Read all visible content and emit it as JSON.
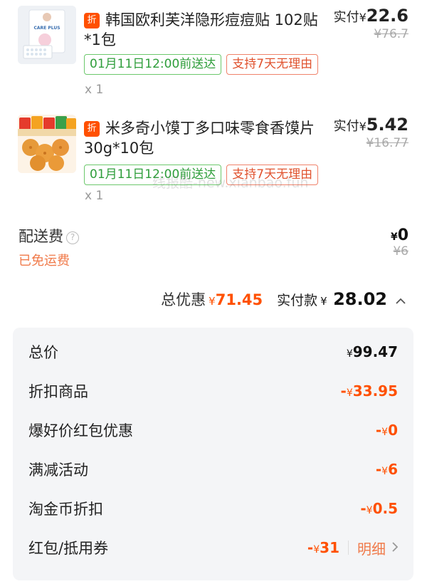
{
  "items": [
    {
      "badge": "折",
      "title": "韩国欧利芙洋隐形痘痘贴 102贴*1包",
      "tag_delivery": "01月11日12:00前送达",
      "tag_return": "支持7天无理由",
      "qty": "x 1",
      "paid_label": "实付",
      "paid_currency": "¥",
      "paid_amount": "22.6",
      "orig_price": "¥76.7",
      "thumb_text": "CARE PLUS"
    },
    {
      "badge": "折",
      "title": "米多奇小馍丁多口味零食香馍片 30g*10包",
      "tag_delivery": "01月11日12:00前送达",
      "tag_return": "支持7天无理由",
      "qty": "x 1",
      "paid_label": "实付",
      "paid_currency": "¥",
      "paid_amount": "5.42",
      "orig_price": "¥16.77"
    }
  ],
  "watermark": "线报酷-new.xianbao.fun",
  "shipping": {
    "label": "配送费",
    "help_icon": "?",
    "free_text": "已免运费",
    "currency": "¥",
    "price": "0",
    "orig_price": "¥6"
  },
  "summary": {
    "discount_label": "总优惠",
    "discount_currency": "¥",
    "discount_amount": "71.45",
    "pay_label": "实付款",
    "pay_currency": "¥",
    "pay_amount": "28.02"
  },
  "breakdown": [
    {
      "label": "总价",
      "prefix": "",
      "currency": "¥",
      "amount": "99.47"
    },
    {
      "label": "折扣商品",
      "prefix": "-",
      "currency": "¥",
      "amount": "33.95"
    },
    {
      "label": "爆好价红包优惠",
      "prefix": "-",
      "currency": "¥",
      "amount": "0"
    },
    {
      "label": "满减活动",
      "prefix": "-",
      "currency": "¥",
      "amount": "6"
    },
    {
      "label": "淘金币折扣",
      "prefix": "-",
      "currency": "¥",
      "amount": "0.5"
    },
    {
      "label": "红包/抵用券",
      "prefix": "-",
      "currency": "¥",
      "amount": "31",
      "detail": "明细"
    }
  ],
  "colors": {
    "accent": "#ff5000",
    "green_tag": "#2e9d3a",
    "red_tag": "#e0522e",
    "panel_bg": "#f4f5f7"
  }
}
